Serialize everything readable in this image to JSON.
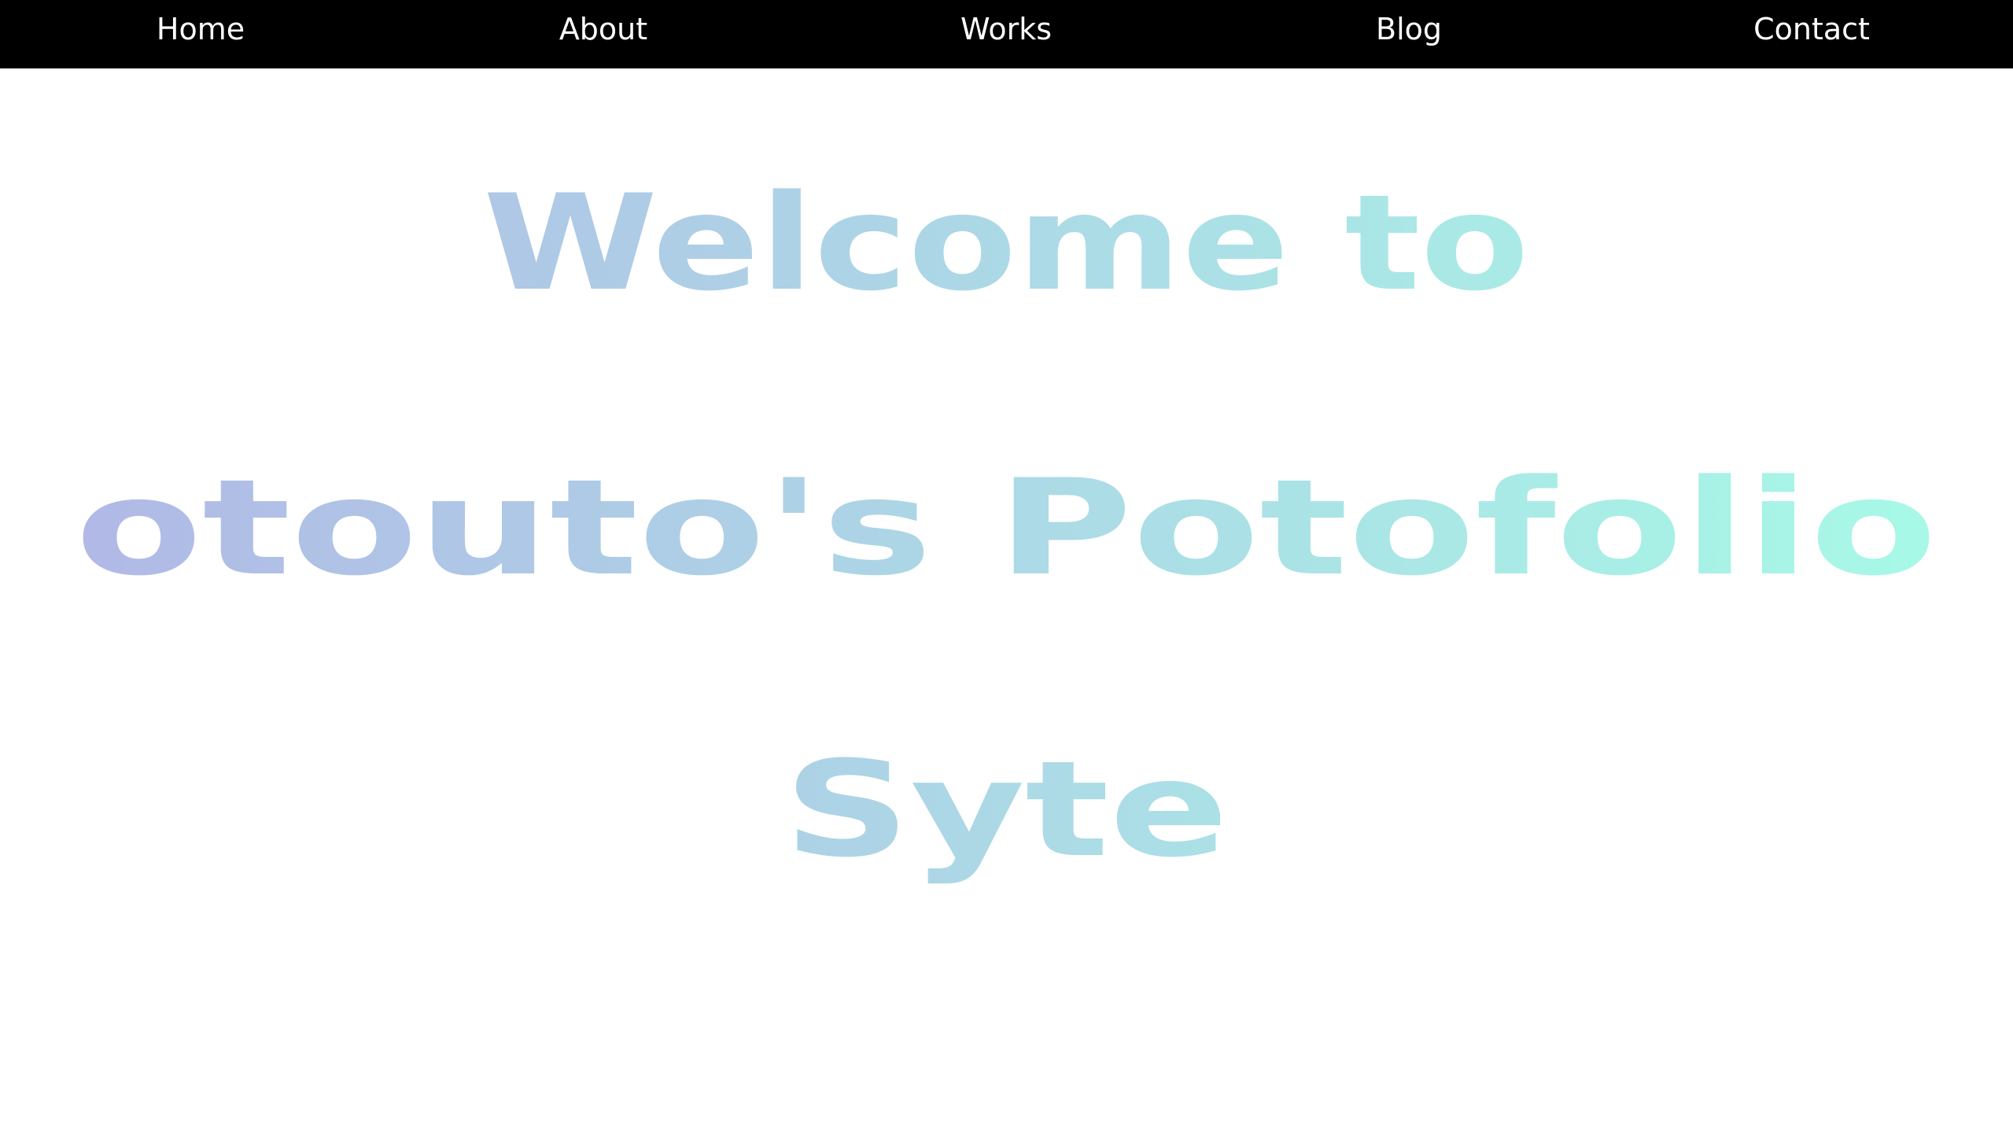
{
  "nav": {
    "items": [
      {
        "label": "Home"
      },
      {
        "label": "About"
      },
      {
        "label": "Works"
      },
      {
        "label": "Blog"
      },
      {
        "label": "Contact"
      }
    ],
    "background": "#000000",
    "text_color": "#ffffff"
  },
  "hero": {
    "lines": [
      "Welcome to",
      "otouto's Potofolio",
      "Syte"
    ],
    "gradient": {
      "start": "#b1b9e6",
      "middle": "#acd9e6",
      "end": "#a7f9e6"
    }
  }
}
